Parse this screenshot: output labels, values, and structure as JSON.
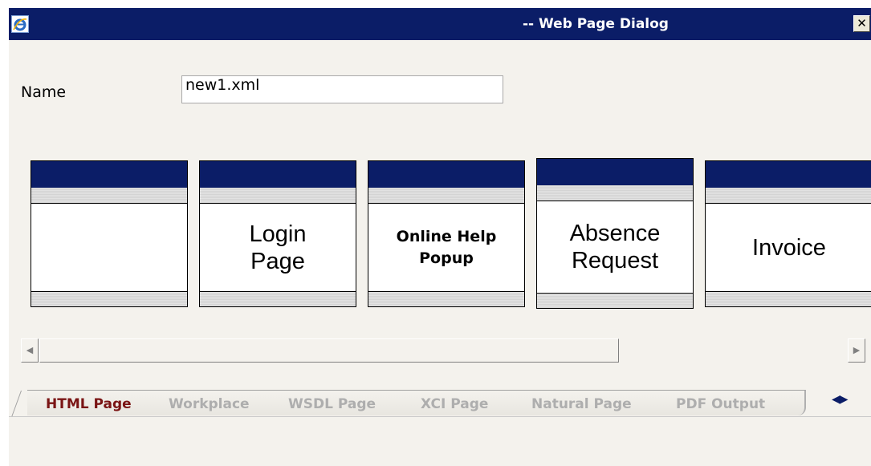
{
  "window": {
    "title": "-- Web Page Dialog",
    "close_glyph": "✕"
  },
  "form": {
    "name_label": "Name",
    "name_value": "new1.xml"
  },
  "templates": [
    {
      "label": ""
    },
    {
      "label": "Login\nPage"
    },
    {
      "label": "Online Help\nPopup"
    },
    {
      "label": "Absence\nRequest"
    },
    {
      "label": "Invoice"
    }
  ],
  "scrollbar": {
    "left_arrow": "◀",
    "right_arrow": "▶"
  },
  "tabs": [
    {
      "label": "HTML Page",
      "active": true
    },
    {
      "label": "Workplace"
    },
    {
      "label": "WSDL Page"
    },
    {
      "label": "XCI Page"
    },
    {
      "label": "Natural Page"
    },
    {
      "label": "PDF Output"
    }
  ],
  "tab_nav": {
    "left": "◀",
    "right": "▶"
  },
  "colors": {
    "titlebar": "#0b1d67",
    "active_tab": "#7a1414",
    "inactive_tab": "#aeaeae"
  }
}
